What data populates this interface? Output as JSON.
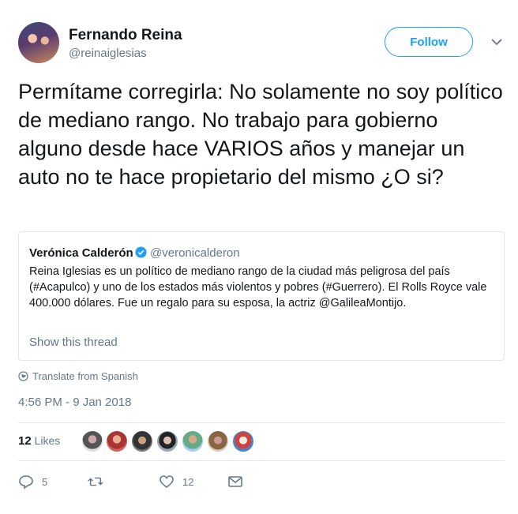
{
  "author": {
    "name": "Fernando Reina",
    "handle": "@reinaiglesias"
  },
  "follow_label": "Follow",
  "tweet_text": "Permítame corregirla: No solamente no soy político de mediano rango. No trabajo para gobierno alguno desde hace VARIOS años y manejar un auto no te hace propietario del mismo ¿O si?",
  "quoted": {
    "name": "Verónica Calderón",
    "handle": "@veronicalderon",
    "text": "Reina Iglesias es un político de mediano rango de la ciudad más peligrosa del país (#Acapulco) y uno de los estados más violentos y pobres (#Guerrero). El Rolls Royce vale 400.000 dólares. Fue un regalo para su esposa, la actriz @GalileaMontijo.",
    "show_thread": "Show this thread"
  },
  "translate_label": "Translate from Spanish",
  "timestamp": "4:56 PM - 9 Jan 2018",
  "likes": {
    "count": "12",
    "label": "Likes"
  },
  "actions": {
    "replies": "5",
    "likes": "12"
  },
  "colors": {
    "accent": "#1da1f2",
    "muted": "#657786",
    "border": "#e1e8ed"
  }
}
